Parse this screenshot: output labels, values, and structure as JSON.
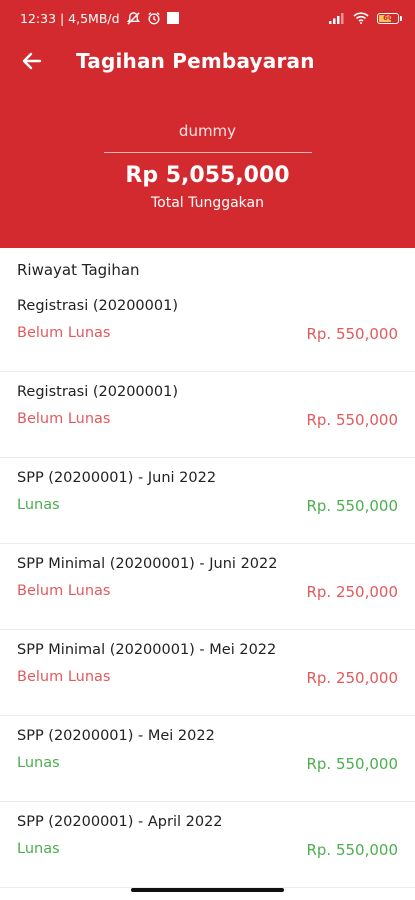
{
  "status_bar": {
    "time_network": "12:33 | 4,5MB/d",
    "battery_level": "60"
  },
  "header": {
    "title": "Tagihan Pembayaran",
    "student_name": "dummy",
    "total_amount": "Rp 5,055,000",
    "total_label": "Total Tunggakan"
  },
  "history": {
    "title": "Riwayat Tagihan",
    "items": [
      {
        "title": "Registrasi (20200001)",
        "status": "Belum Lunas",
        "amount": "Rp. 550,000"
      },
      {
        "title": "Registrasi (20200001)",
        "status": "Belum Lunas",
        "amount": "Rp. 550,000"
      },
      {
        "title": "SPP (20200001) - Juni 2022",
        "status": "Lunas",
        "amount": "Rp. 550,000"
      },
      {
        "title": "SPP Minimal (20200001) - Juni 2022",
        "status": "Belum Lunas",
        "amount": "Rp. 250,000"
      },
      {
        "title": "SPP Minimal (20200001) - Mei 2022",
        "status": "Belum Lunas",
        "amount": "Rp. 250,000"
      },
      {
        "title": "SPP (20200001) - Mei 2022",
        "status": "Lunas",
        "amount": "Rp. 550,000"
      },
      {
        "title": "SPP (20200001) - April 2022",
        "status": "Lunas",
        "amount": "Rp. 550,000"
      }
    ]
  },
  "colors": {
    "header_red": "#d32a2f",
    "unpaid": "#e15a5d",
    "paid": "#4caf50"
  }
}
